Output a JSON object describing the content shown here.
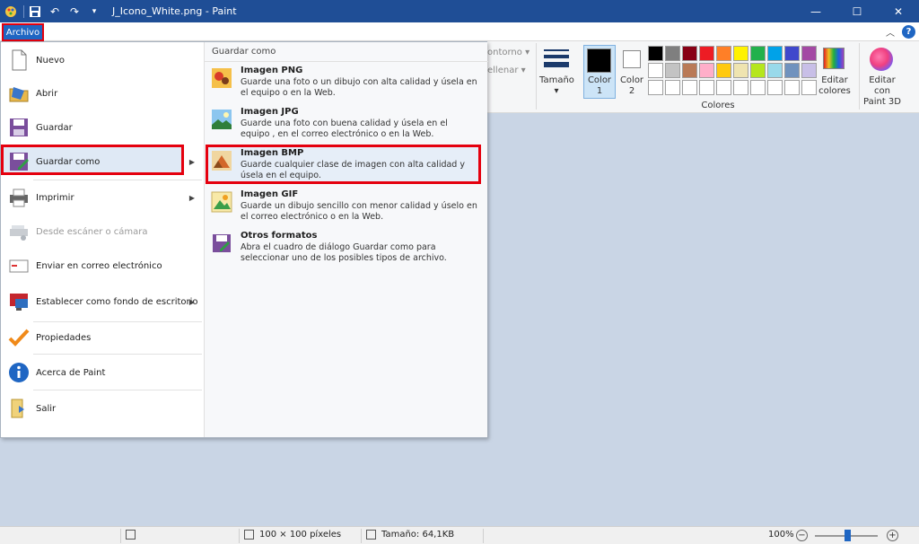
{
  "titlebar": {
    "title": "J_Icono_White.png - Paint",
    "controls": [
      "minimize",
      "maximize",
      "close"
    ]
  },
  "tabs": {
    "archivo": "Archivo"
  },
  "ribbon": {
    "contorno": "ontorno",
    "rellenar": "ellenar",
    "tamano": "Tamaño",
    "color1_line1": "Color",
    "color1_line2": "1",
    "color2_line1": "Color",
    "color2_line2": "2",
    "colores_group": "Colores",
    "editar_colores_line1": "Editar",
    "editar_colores_line2": "colores",
    "paint3d_line1": "Editar con",
    "paint3d_line2": "Paint 3D",
    "palette_row1": [
      "#000000",
      "#7f7f7f",
      "#880015",
      "#ed1c24",
      "#ff7f27",
      "#fff200",
      "#22b14c",
      "#00a2e8",
      "#3f48cc",
      "#a349a4"
    ],
    "palette_row2": [
      "#ffffff",
      "#c3c3c3",
      "#b97a57",
      "#ffaec9",
      "#ffc90e",
      "#efe4b0",
      "#b5e61d",
      "#99d9ea",
      "#7092be",
      "#c8bfe7"
    ],
    "palette_row3": [
      "#ffffff",
      "#ffffff",
      "#ffffff",
      "#ffffff",
      "#ffffff",
      "#ffffff",
      "#ffffff",
      "#ffffff",
      "#ffffff",
      "#ffffff"
    ]
  },
  "file_menu": {
    "items": [
      {
        "label": "Nuevo",
        "icon": "new-file-icon"
      },
      {
        "label": "Abrir",
        "icon": "open-folder-icon"
      },
      {
        "label": "Guardar",
        "icon": "save-disk-icon"
      },
      {
        "label": "Guardar como",
        "icon": "save-as-icon",
        "submenu": true
      },
      {
        "label": "Imprimir",
        "icon": "printer-icon",
        "submenu": true
      },
      {
        "label": "Desde escáner o cámara",
        "icon": "scanner-icon",
        "disabled": true
      },
      {
        "label": "Enviar en correo electrónico",
        "icon": "email-icon"
      },
      {
        "label": "Establecer como fondo de escritorio",
        "icon": "desktop-background-icon",
        "submenu": true
      },
      {
        "label": "Propiedades",
        "icon": "checkmark-icon"
      },
      {
        "label": "Acerca de Paint",
        "icon": "info-icon"
      },
      {
        "label": "Salir",
        "icon": "exit-icon"
      }
    ],
    "saveas_header": "Guardar como",
    "saveas_items": [
      {
        "title": "Imagen PNG",
        "desc": "Guarde una foto o un dibujo con alta calidad y úsela en el equipo o en la Web."
      },
      {
        "title": "Imagen JPG",
        "desc": "Guarde una foto con buena calidad y úsela en el equipo , en el correo electrónico o en la Web."
      },
      {
        "title": "Imagen BMP",
        "desc": "Guarde cualquier clase de imagen con alta calidad y úsela en el equipo."
      },
      {
        "title": "Imagen GIF",
        "desc": "Guarde un dibujo sencillo con menor calidad y úselo en el correo electrónico o en la Web."
      },
      {
        "title": "Otros formatos",
        "desc": "Abra el cuadro de diálogo Guardar como para seleccionar uno de los posibles tipos de archivo."
      }
    ]
  },
  "status": {
    "dimensions": "100 × 100 píxeles",
    "size": "Tamaño: 64,1KB",
    "zoom": "100%"
  },
  "colors": {
    "titlebar": "#1f4e96",
    "accent": "#1f66c3",
    "highlight": "#e5000e",
    "canvas_bg": "#c9d5e5"
  }
}
